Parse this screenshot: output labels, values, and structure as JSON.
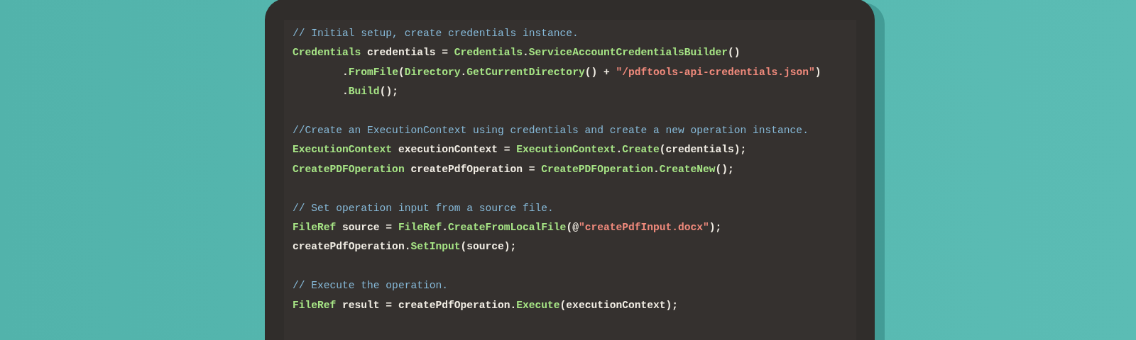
{
  "code_blocks": [
    {
      "lines": [
        [
          {
            "kind": "comment",
            "text": "// Initial setup, create credentials instance."
          }
        ],
        [
          {
            "kind": "type",
            "text": "Credentials"
          },
          {
            "kind": "plain",
            "text": " credentials = "
          },
          {
            "kind": "type",
            "text": "Credentials"
          },
          {
            "kind": "plain",
            "text": "."
          },
          {
            "kind": "method",
            "text": "ServiceAccountCredentialsBuilder"
          },
          {
            "kind": "plain",
            "text": "()"
          }
        ],
        [
          {
            "kind": "plain",
            "text": "        ."
          },
          {
            "kind": "method",
            "text": "FromFile"
          },
          {
            "kind": "plain",
            "text": "("
          },
          {
            "kind": "type",
            "text": "Directory"
          },
          {
            "kind": "plain",
            "text": "."
          },
          {
            "kind": "method",
            "text": "GetCurrentDirectory"
          },
          {
            "kind": "plain",
            "text": "() + "
          },
          {
            "kind": "string",
            "text": "\"/pdftools-api-credentials.json\""
          },
          {
            "kind": "plain",
            "text": ")"
          }
        ],
        [
          {
            "kind": "plain",
            "text": "        ."
          },
          {
            "kind": "method",
            "text": "Build"
          },
          {
            "kind": "plain",
            "text": "();"
          }
        ]
      ]
    },
    {
      "lines": [
        [
          {
            "kind": "comment",
            "text": "//Create an ExecutionContext using credentials and create a new operation instance."
          }
        ],
        [
          {
            "kind": "type",
            "text": "ExecutionContext"
          },
          {
            "kind": "plain",
            "text": " executionContext = "
          },
          {
            "kind": "type",
            "text": "ExecutionContext"
          },
          {
            "kind": "plain",
            "text": "."
          },
          {
            "kind": "method",
            "text": "Create"
          },
          {
            "kind": "plain",
            "text": "(credentials);"
          }
        ],
        [
          {
            "kind": "type",
            "text": "CreatePDFOperation"
          },
          {
            "kind": "plain",
            "text": " createPdfOperation = "
          },
          {
            "kind": "type",
            "text": "CreatePDFOperation"
          },
          {
            "kind": "plain",
            "text": "."
          },
          {
            "kind": "method",
            "text": "CreateNew"
          },
          {
            "kind": "plain",
            "text": "();"
          }
        ]
      ]
    },
    {
      "lines": [
        [
          {
            "kind": "comment",
            "text": "// Set operation input from a source file."
          }
        ],
        [
          {
            "kind": "type",
            "text": "FileRef"
          },
          {
            "kind": "plain",
            "text": " source = "
          },
          {
            "kind": "type",
            "text": "FileRef"
          },
          {
            "kind": "plain",
            "text": "."
          },
          {
            "kind": "method",
            "text": "CreateFromLocalFile"
          },
          {
            "kind": "plain",
            "text": "(@"
          },
          {
            "kind": "string",
            "text": "\"createPdfInput.docx\""
          },
          {
            "kind": "plain",
            "text": ");"
          }
        ],
        [
          {
            "kind": "plain",
            "text": "createPdfOperation."
          },
          {
            "kind": "method",
            "text": "SetInput"
          },
          {
            "kind": "plain",
            "text": "(source);"
          }
        ]
      ]
    },
    {
      "lines": [
        [
          {
            "kind": "comment",
            "text": "// Execute the operation."
          }
        ],
        [
          {
            "kind": "type",
            "text": "FileRef"
          },
          {
            "kind": "plain",
            "text": " result = createPdfOperation."
          },
          {
            "kind": "method",
            "text": "Execute"
          },
          {
            "kind": "plain",
            "text": "(executionContext);"
          }
        ]
      ]
    }
  ]
}
